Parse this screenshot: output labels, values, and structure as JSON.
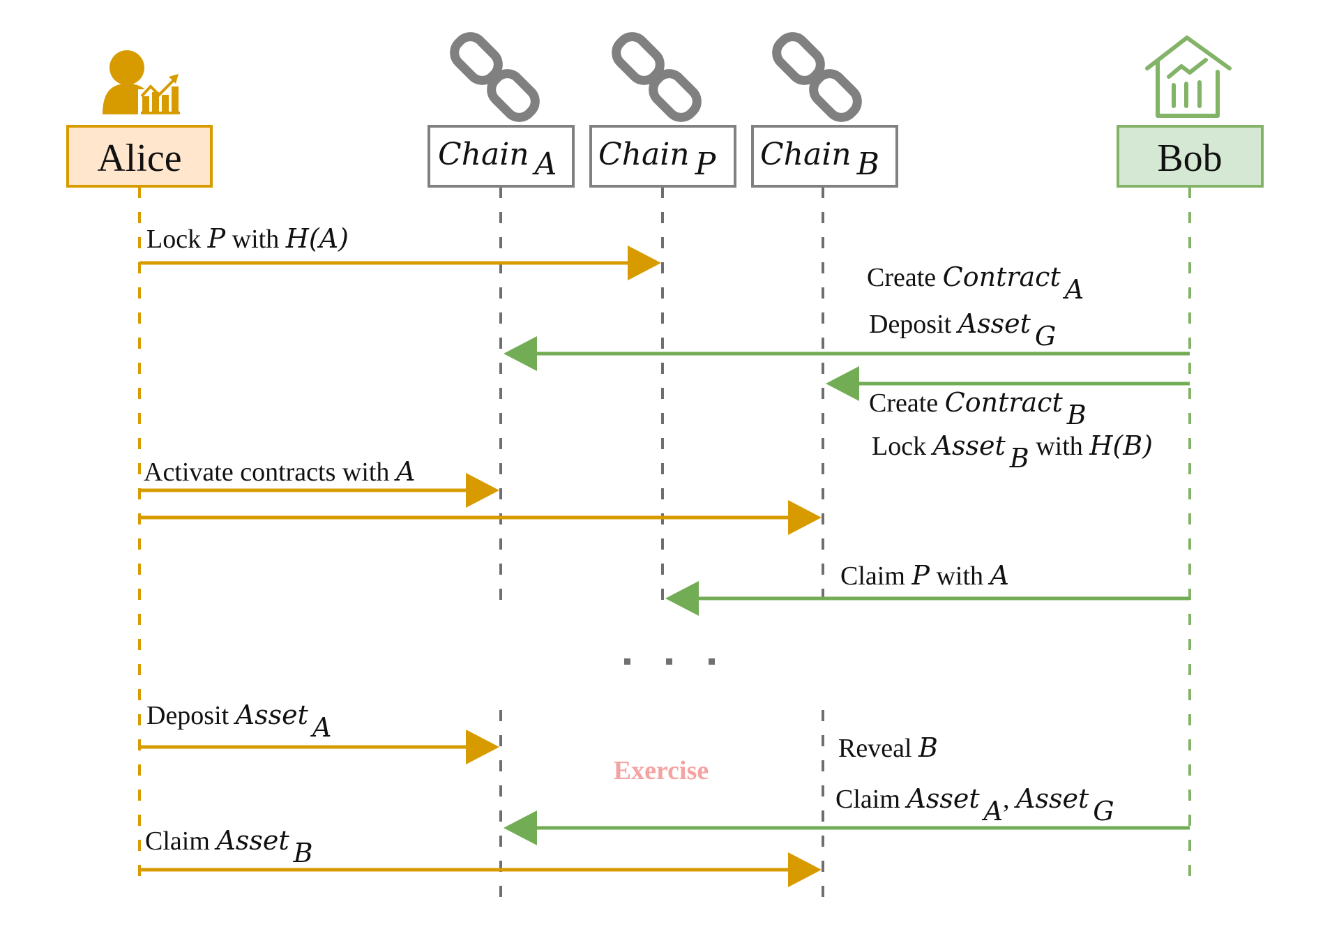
{
  "colors": {
    "alice_stroke": "#d79b00",
    "alice_fill": "#ffe6cc",
    "bob_stroke": "#82b366",
    "bob_fill": "#d5e8d4",
    "chain_stroke": "#808080",
    "chain_fill": "#ffffff",
    "alice_arrow": "#d79b00",
    "bob_arrow": "#72ad55",
    "exercise_text": "#f4a3a3",
    "ellipsis": "#707070"
  },
  "participants": [
    {
      "id": "alice",
      "name": "Alice",
      "icon": "investor-person-icon",
      "kind": "actor"
    },
    {
      "id": "chainA",
      "name": "Chain",
      "sub": "A",
      "icon": "chain-link-icon",
      "kind": "chain"
    },
    {
      "id": "chainP",
      "name": "Chain",
      "sub": "P",
      "icon": "chain-link-icon",
      "kind": "chain"
    },
    {
      "id": "chainB",
      "name": "Chain",
      "sub": "B",
      "icon": "chain-link-icon",
      "kind": "chain"
    },
    {
      "id": "bob",
      "name": "Bob",
      "icon": "bank-building-icon",
      "kind": "actor"
    }
  ],
  "messages": [
    {
      "from": "alice",
      "to": "chainP",
      "labels": [
        [
          {
            "t": "Lock "
          },
          {
            "t": "P",
            "i": true
          },
          {
            "t": " with "
          },
          {
            "t": "H(A)",
            "i": true
          }
        ]
      ]
    },
    {
      "from": "bob",
      "to": "chainA",
      "labels": [
        [
          {
            "t": "Create "
          },
          {
            "t": "Contract",
            "i": true
          },
          {
            "t": "A",
            "i": true,
            "sub": true
          }
        ],
        [
          {
            "t": "Deposit "
          },
          {
            "t": "Asset",
            "i": true
          },
          {
            "t": "G",
            "i": true,
            "sub": true
          }
        ]
      ]
    },
    {
      "from": "bob",
      "to": "chainB",
      "labels": [
        [
          {
            "t": "Create "
          },
          {
            "t": "Contract",
            "i": true
          },
          {
            "t": "B",
            "i": true,
            "sub": true
          }
        ],
        [
          {
            "t": "Lock "
          },
          {
            "t": "Asset",
            "i": true
          },
          {
            "t": "B",
            "i": true,
            "sub": true
          },
          {
            "t": " with "
          },
          {
            "t": "H(B)",
            "i": true
          }
        ]
      ]
    },
    {
      "from": "alice",
      "to": "chainA",
      "labels": [
        [
          {
            "t": "Activate contracts with "
          },
          {
            "t": "A",
            "i": true
          }
        ]
      ]
    },
    {
      "from": "alice",
      "to": "chainB",
      "labels": []
    },
    {
      "from": "bob",
      "to": "chainP",
      "labels": [
        [
          {
            "t": "Claim "
          },
          {
            "t": "P",
            "i": true
          },
          {
            "t": " with "
          },
          {
            "t": "A",
            "i": true
          }
        ]
      ]
    },
    {
      "from": "alice",
      "to": "chainA",
      "labels": [
        [
          {
            "t": "Deposit "
          },
          {
            "t": "Asset",
            "i": true
          },
          {
            "t": "A",
            "i": true,
            "sub": true
          }
        ]
      ]
    },
    {
      "from": "bob",
      "to": "chainA",
      "labels": [
        [
          {
            "t": "Reveal "
          },
          {
            "t": "B",
            "i": true
          }
        ],
        [
          {
            "t": "Claim "
          },
          {
            "t": "Asset",
            "i": true
          },
          {
            "t": "A",
            "i": true,
            "sub": true
          },
          {
            "t": ", "
          },
          {
            "t": "Asset",
            "i": true
          },
          {
            "t": "G",
            "i": true,
            "sub": true
          }
        ]
      ]
    },
    {
      "from": "alice",
      "to": "chainB",
      "labels": [
        [
          {
            "t": "Claim "
          },
          {
            "t": "Asset",
            "i": true
          },
          {
            "t": "B",
            "i": true,
            "sub": true
          }
        ]
      ]
    }
  ],
  "ellipsis": "· · ·",
  "phase_label": "Exercise"
}
